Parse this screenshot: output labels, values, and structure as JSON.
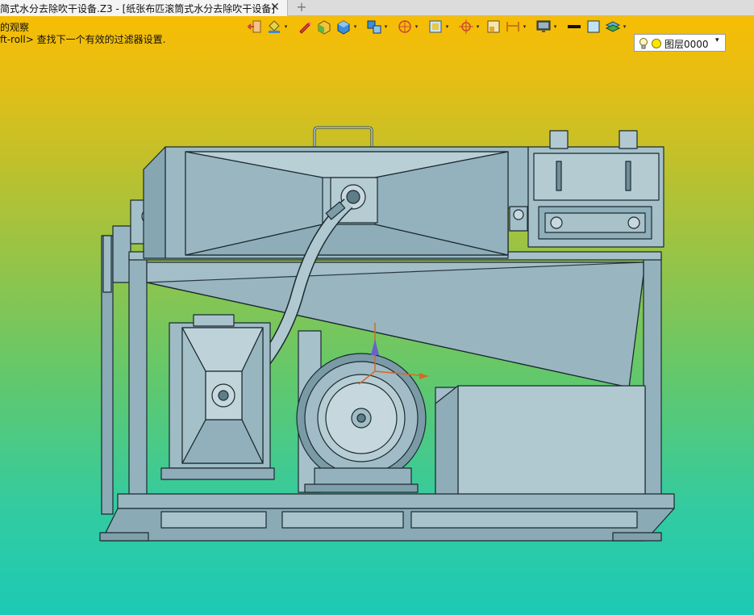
{
  "tab": {
    "title": "简式水分去除吹干设备.Z3 - [纸张布匹滚筒式水分去除吹干设备]",
    "close_glyph": "✕",
    "add_glyph": "+"
  },
  "command": {
    "line1": "的观察",
    "line2": "ft-roll> 查找下一个有效的过滤器设置."
  },
  "toolbar": {
    "buttons": [
      "exit-sketch-icon",
      "paint-bucket-icon",
      "pencil-icon",
      "shaded-box-icon",
      "cube-view-icon",
      "multi-cube-icon",
      "render-mode-icon",
      "sketch-frame-icon",
      "snap-target-icon",
      "frame-icon",
      "dimension-icon",
      "monitor-icon",
      "line-color-icon",
      "fill-color-icon",
      "layer-stack-icon"
    ],
    "caret_glyph": "▾"
  },
  "layer": {
    "name": "图层0000",
    "arrow": "▾",
    "bulb_icon": "light-bulb-icon",
    "color_icon": "layer-color-dot-icon",
    "color": "#ffe600"
  },
  "colors": {
    "tab_bar": "#dcdcdc",
    "viewport_top": "#f7bd04",
    "viewport_bottom": "#1ccab5",
    "model_fill": "#8fb3bf",
    "model_stroke": "#1b2a30"
  }
}
